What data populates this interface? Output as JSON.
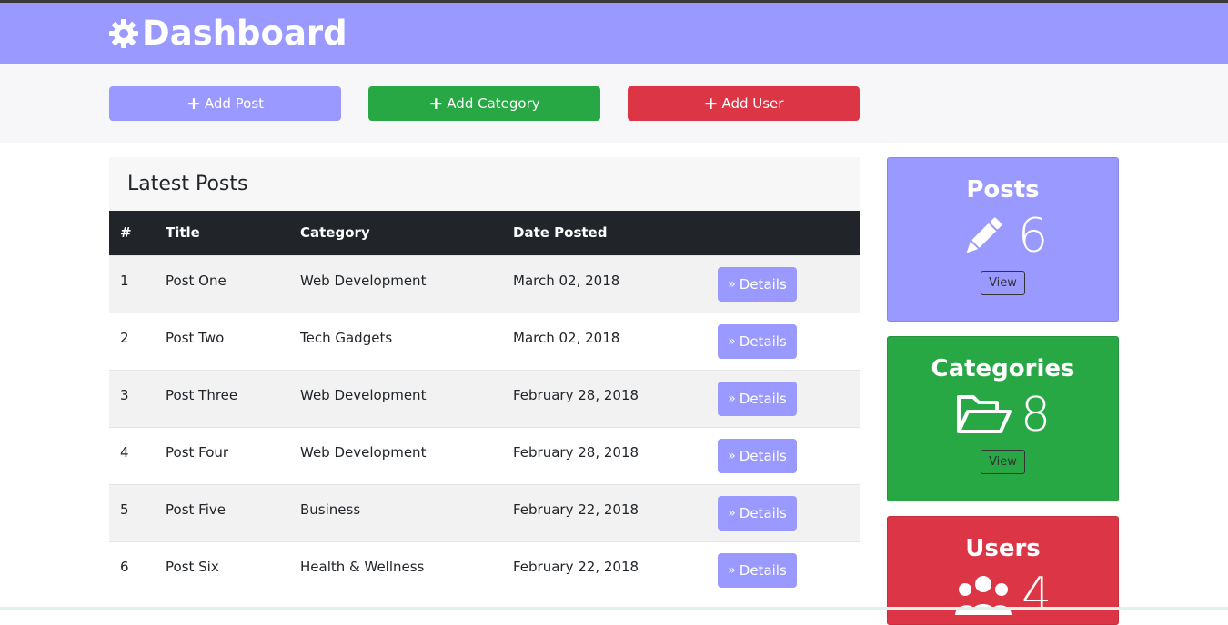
{
  "header": {
    "title": "Dashboard",
    "icon": "gear-icon"
  },
  "actions": {
    "add_post": "Add Post",
    "add_category": "Add Category",
    "add_user": "Add User"
  },
  "posts": {
    "title": "Latest Posts",
    "columns": [
      "#",
      "Title",
      "Category",
      "Date Posted"
    ],
    "details_label": "Details",
    "rows": [
      {
        "num": "1",
        "title": "Post One",
        "category": "Web Development",
        "date": "March 02, 2018"
      },
      {
        "num": "2",
        "title": "Post Two",
        "category": "Tech Gadgets",
        "date": "March 02, 2018"
      },
      {
        "num": "3",
        "title": "Post Three",
        "category": "Web Development",
        "date": "February 28, 2018"
      },
      {
        "num": "4",
        "title": "Post Four",
        "category": "Web Development",
        "date": "February 28, 2018"
      },
      {
        "num": "5",
        "title": "Post Five",
        "category": "Business",
        "date": "February 22, 2018"
      },
      {
        "num": "6",
        "title": "Post Six",
        "category": "Health & Wellness",
        "date": "February 22, 2018"
      }
    ]
  },
  "cards": {
    "posts": {
      "title": "Posts",
      "count": "6",
      "view": "View",
      "icon": "pencil-icon"
    },
    "categories": {
      "title": "Categories",
      "count": "8",
      "view": "View",
      "icon": "folder-open-icon"
    },
    "users": {
      "title": "Users",
      "count": "4",
      "icon": "users-icon"
    }
  },
  "colors": {
    "primary": "#9999ff",
    "success": "#28a745",
    "danger": "#dc3545",
    "dark": "#212529"
  }
}
